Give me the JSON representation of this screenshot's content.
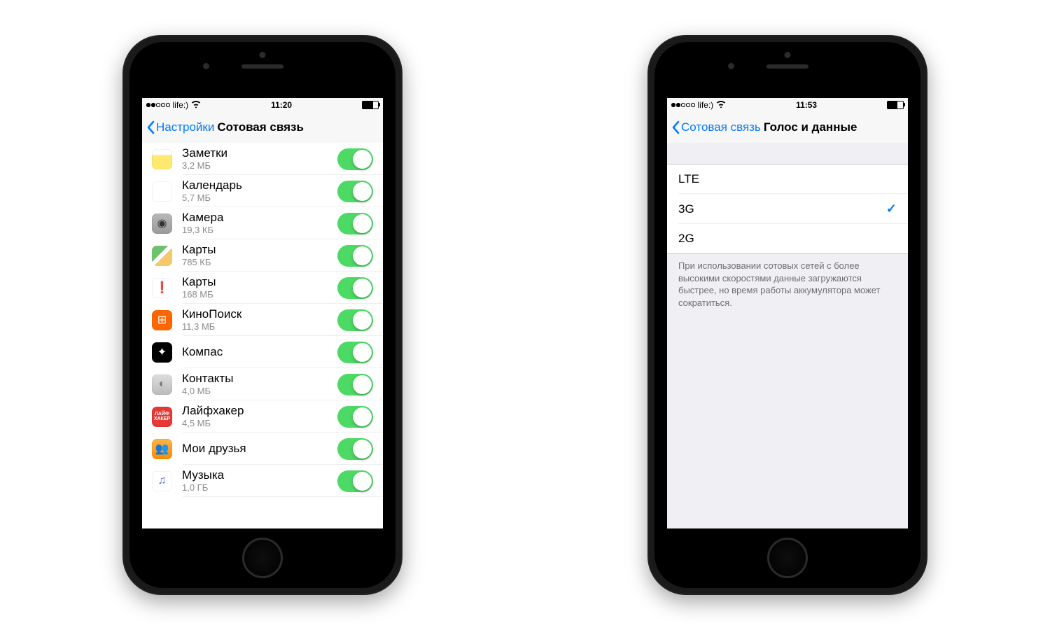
{
  "phone1": {
    "status": {
      "carrier": "life:)",
      "time": "11:20",
      "signal_filled": 2,
      "battery_level": 70
    },
    "nav": {
      "back": "Настройки",
      "title": "Сотовая связь"
    },
    "apps": [
      {
        "name": "Заметки",
        "size": "3,2 МБ",
        "icon": "notes",
        "on": true
      },
      {
        "name": "Календарь",
        "size": "5,7 МБ",
        "icon": "cal",
        "on": true
      },
      {
        "name": "Камера",
        "size": "19,3 КБ",
        "icon": "cam",
        "on": true
      },
      {
        "name": "Карты",
        "size": "785 КБ",
        "icon": "amaps",
        "on": true
      },
      {
        "name": "Карты",
        "size": "168 МБ",
        "icon": "ymaps",
        "on": true
      },
      {
        "name": "КиноПоиск",
        "size": "11,3 МБ",
        "icon": "kino",
        "on": true
      },
      {
        "name": "Компас",
        "size": "",
        "icon": "compass",
        "on": true
      },
      {
        "name": "Контакты",
        "size": "4,0 МБ",
        "icon": "contacts",
        "on": true
      },
      {
        "name": "Лайфхакер",
        "size": "4,5 МБ",
        "icon": "life",
        "on": true
      },
      {
        "name": "Мои друзья",
        "size": "",
        "icon": "friends",
        "on": true
      },
      {
        "name": "Музыка",
        "size": "1,0 ГБ",
        "icon": "music",
        "on": true
      }
    ]
  },
  "phone2": {
    "status": {
      "carrier": "life:)",
      "time": "11:53",
      "signal_filled": 2,
      "battery_level": 65
    },
    "nav": {
      "back": "Сотовая связь",
      "title": "Голос и данные"
    },
    "options": [
      {
        "label": "LTE",
        "selected": false
      },
      {
        "label": "3G",
        "selected": true
      },
      {
        "label": "2G",
        "selected": false
      }
    ],
    "footer": "При использовании сотовых сетей с более высокими скоростями данные загружаются быстрее, но время работы аккумулятора может сократиться."
  }
}
